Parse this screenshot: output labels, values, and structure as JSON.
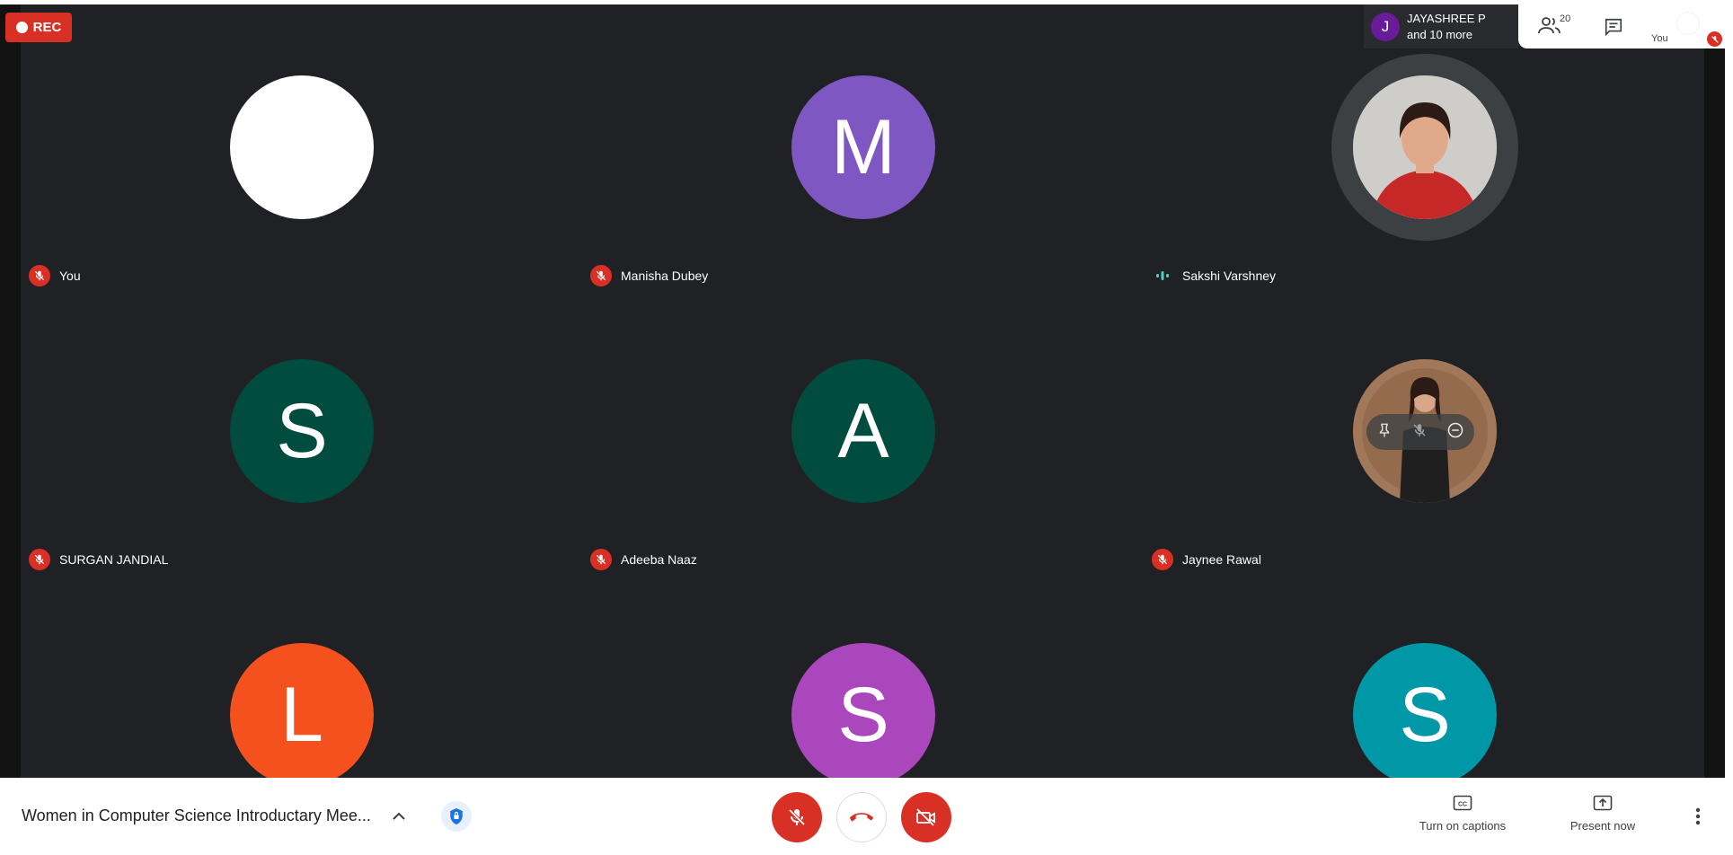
{
  "recording": {
    "label": "REC"
  },
  "presenter": {
    "initial": "J",
    "name": "JAYASHREE P",
    "others": "and 10 more"
  },
  "top_panel": {
    "people_count": "20",
    "self_label": "You"
  },
  "participants": [
    {
      "name": "You",
      "initial": "",
      "color": "#ffffff",
      "status": "muted",
      "kind": "letter"
    },
    {
      "name": "Manisha Dubey",
      "initial": "M",
      "color": "#7e57c2",
      "status": "muted",
      "kind": "letter"
    },
    {
      "name": "Sakshi Varshney",
      "initial": "",
      "color": "#c62828",
      "status": "speaking",
      "kind": "photo"
    },
    {
      "name": "SURGAN JANDIAL",
      "initial": "S",
      "color": "#004d40",
      "status": "muted",
      "kind": "letter"
    },
    {
      "name": "Adeeba Naaz",
      "initial": "A",
      "color": "#004d40",
      "status": "muted",
      "kind": "letter"
    },
    {
      "name": "Jaynee Rawal",
      "initial": "",
      "color": "#8d6e63",
      "status": "muted",
      "kind": "photo"
    },
    {
      "name": "",
      "initial": "L",
      "color": "#f4511e",
      "status": "",
      "kind": "letter"
    },
    {
      "name": "",
      "initial": "S",
      "color": "#ab47bc",
      "status": "",
      "kind": "letter"
    },
    {
      "name": "",
      "initial": "S",
      "color": "#0097a7",
      "status": "",
      "kind": "letter"
    }
  ],
  "bottom_bar": {
    "meeting_title": "Women in Computer Science Introductary Mee...",
    "captions_label": "Turn on captions",
    "present_label": "Present now"
  },
  "colors": {
    "danger": "#d93025",
    "stage": "#202124",
    "speaking": "#4fd1c5",
    "lock": "#1a73e8"
  }
}
